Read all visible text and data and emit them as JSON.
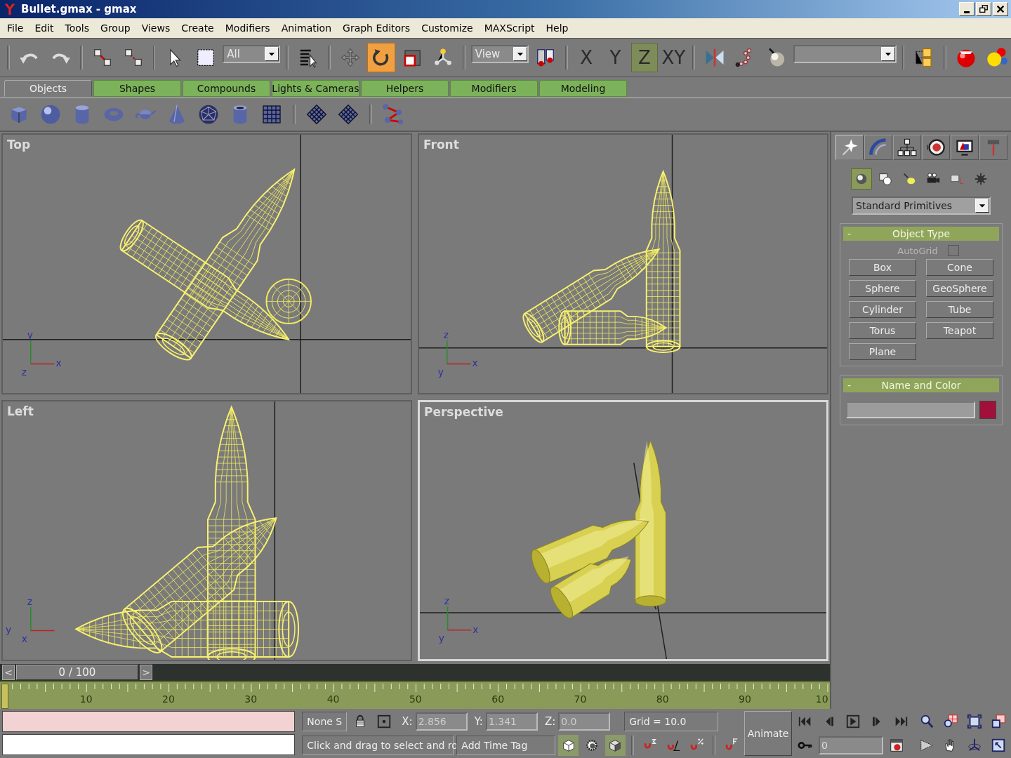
{
  "window": {
    "title": "Bullet.gmax - gmax"
  },
  "menu": [
    "File",
    "Edit",
    "Tools",
    "Group",
    "Views",
    "Create",
    "Modifiers",
    "Animation",
    "Graph Editors",
    "Customize",
    "MAXScript",
    "Help"
  ],
  "toolbar": [
    [
      {
        "kind": "icon",
        "selected": false
      },
      {
        "kind": "icon",
        "selected": false
      }
    ],
    [
      {
        "kind": "icon",
        "selected": false
      },
      {
        "kind": "icon",
        "selected": false
      }
    ],
    [
      {
        "kind": "icon",
        "selected": false
      },
      {
        "kind": "icon",
        "selected": false
      },
      {
        "kind": "dropdown",
        "value": "All"
      }
    ],
    [
      {
        "kind": "icon",
        "selected": false
      }
    ],
    [
      {
        "kind": "icon",
        "selected": false
      },
      {
        "kind": "icon",
        "selected": true
      },
      {
        "kind": "icon",
        "selected": false
      },
      {
        "kind": "icon",
        "selected": false
      }
    ],
    [
      {
        "kind": "dropdown",
        "value": "View"
      },
      {
        "kind": "icon",
        "selected": false
      }
    ],
    [
      {
        "kind": "axis",
        "label": "X",
        "selected": false
      },
      {
        "kind": "axis",
        "label": "Y",
        "selected": false
      },
      {
        "kind": "axis",
        "label": "Z",
        "selected": true
      },
      {
        "kind": "axis",
        "label": "XY",
        "selected": false
      }
    ],
    [
      {
        "kind": "icon",
        "selected": false
      },
      {
        "kind": "icon",
        "selected": false
      },
      {
        "kind": "icon",
        "selected": false
      },
      {
        "kind": "dropdown"
      }
    ],
    [
      {
        "kind": "icon",
        "selected": false
      }
    ],
    [
      {
        "kind": "icon",
        "selected": false
      },
      {
        "kind": "icon",
        "selected": false
      }
    ]
  ],
  "tabs": [
    {
      "label": "Objects",
      "selected": true
    },
    {
      "label": "Shapes",
      "selected": false
    },
    {
      "label": "Compounds",
      "selected": false
    },
    {
      "label": "Lights & Cameras",
      "selected": false
    },
    {
      "label": "Helpers",
      "selected": false
    },
    {
      "label": "Modifiers",
      "selected": false
    },
    {
      "label": "Modeling",
      "selected": false
    }
  ],
  "viewports": [
    {
      "label": "Top",
      "active": false,
      "kind": "wireframe",
      "axes": {
        "up": "y",
        "origin": "z",
        "right": "x"
      }
    },
    {
      "label": "Front",
      "active": false,
      "kind": "wireframe",
      "axes": {
        "up": "z",
        "origin": "y",
        "right": "x"
      }
    },
    {
      "label": "Left",
      "active": false,
      "kind": "wireframe",
      "axes": {
        "up": "z",
        "left": "y",
        "origin": "x"
      }
    },
    {
      "label": "Perspective",
      "active": true,
      "kind": "smooth",
      "axes": {
        "up": "z",
        "origin": "y",
        "right": "x"
      }
    }
  ],
  "command_panel": {
    "tabs": [
      {
        "selected": true
      },
      {
        "selected": false
      },
      {
        "selected": false
      },
      {
        "selected": false
      },
      {
        "selected": false
      },
      {
        "selected": false
      }
    ],
    "categories": [
      {
        "selected": true
      },
      {
        "selected": false
      },
      {
        "selected": false
      },
      {
        "selected": false
      },
      {
        "selected": false
      },
      {
        "selected": false
      }
    ],
    "dropdown": "Standard Primitives",
    "rollouts": [
      {
        "kind": "buttons",
        "toggle": "-",
        "title": "Object Type",
        "autogrid": {
          "label": "AutoGrid",
          "disabled": true,
          "checked": false
        },
        "buttons": [
          "Box",
          "Cone",
          "Sphere",
          "GeoSphere",
          "Cylinder",
          "Tube",
          "Torus",
          "Teapot",
          "Plane"
        ]
      },
      {
        "kind": "name_color",
        "toggle": "-",
        "title": "Name and Color",
        "color": "#a0103a"
      }
    ]
  },
  "timeline": {
    "prev": "<",
    "position": "0 / 100",
    "next": ">",
    "ruler": [
      "10",
      "20",
      "30",
      "40",
      "50",
      "60",
      "70",
      "80",
      "90",
      "10"
    ]
  },
  "status": {
    "selection": "None S",
    "coords": [
      {
        "label": "X:",
        "value": "2.856"
      },
      {
        "label": "Y:",
        "value": "1.341"
      },
      {
        "label": "Z:",
        "value": "0.0"
      }
    ],
    "grid": "Grid = 10.0",
    "prompt": "Click and drag to select and ro",
    "time_tag": "Add Time Tag",
    "animate": "Animate",
    "frame": "0"
  }
}
